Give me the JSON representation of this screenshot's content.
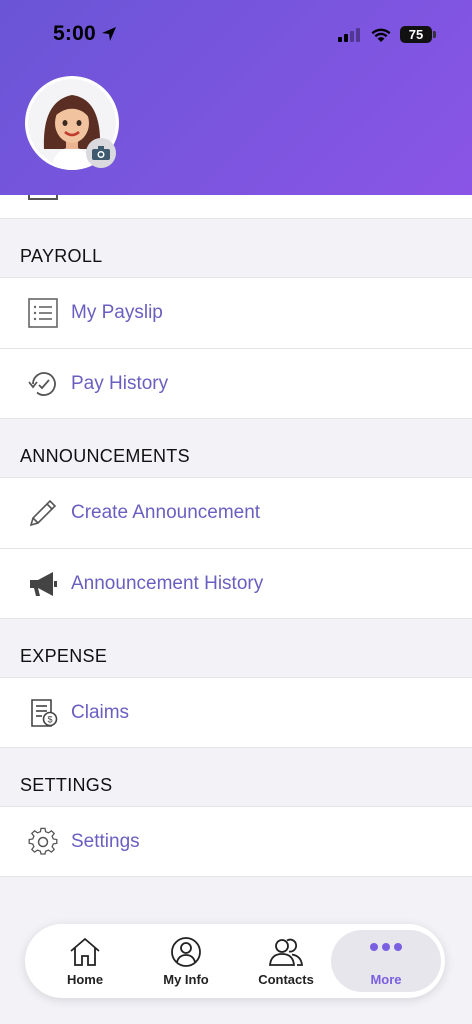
{
  "status_bar": {
    "time": "5:00",
    "battery": "75"
  },
  "sections": [
    {
      "title": "PAYROLL",
      "items": [
        {
          "label": "My Payslip",
          "icon": "payslip-list-icon"
        },
        {
          "label": "Pay History",
          "icon": "history-clock-icon"
        }
      ]
    },
    {
      "title": "ANNOUNCEMENTS",
      "items": [
        {
          "label": "Create Announcement",
          "icon": "pencil-icon"
        },
        {
          "label": "Announcement History",
          "icon": "megaphone-icon"
        }
      ]
    },
    {
      "title": "EXPENSE",
      "items": [
        {
          "label": "Claims",
          "icon": "claims-receipt-icon"
        }
      ]
    },
    {
      "title": "SETTINGS",
      "items": [
        {
          "label": "Settings",
          "icon": "gear-icon"
        }
      ]
    }
  ],
  "tabbar": {
    "tabs": [
      {
        "label": "Home",
        "icon": "home-icon"
      },
      {
        "label": "My Info",
        "icon": "user-icon"
      },
      {
        "label": "Contacts",
        "icon": "contacts-icon"
      },
      {
        "label": "More",
        "icon": "more-dots-icon",
        "active": true
      }
    ]
  },
  "colors": {
    "accent": "#6a5fc1",
    "header": "#7a55e0"
  }
}
